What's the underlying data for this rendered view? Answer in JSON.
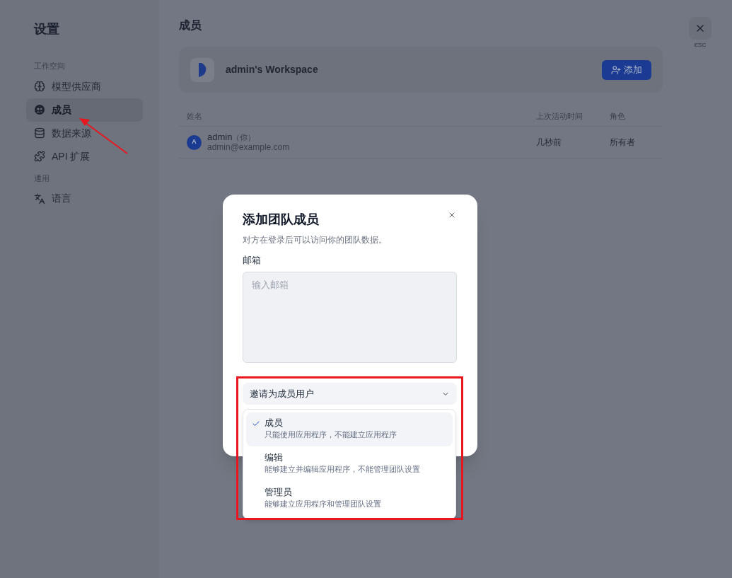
{
  "sidebar": {
    "title": "设置",
    "sections": [
      {
        "heading": "工作空间",
        "items": [
          {
            "label": "模型供应商",
            "kind": "brain",
            "selected": false
          },
          {
            "label": "成员",
            "kind": "members",
            "selected": true
          },
          {
            "label": "数据来源",
            "kind": "database",
            "selected": false
          },
          {
            "label": "API 扩展",
            "kind": "puzzle",
            "selected": false
          }
        ]
      },
      {
        "heading": "通用",
        "items": [
          {
            "label": "语言",
            "kind": "language",
            "selected": false
          }
        ]
      }
    ]
  },
  "main": {
    "title": "成员",
    "close": {
      "hint": "ESC"
    },
    "workspace": {
      "name": "admin's Workspace",
      "add_button": "添加"
    },
    "table": {
      "columns": [
        "姓名",
        "上次活动时间",
        "角色"
      ],
      "rows": [
        {
          "avatar": "A",
          "name": "admin",
          "tag": "（你）",
          "email": "admin@example.com",
          "last_active": "几秒前",
          "role": "所有者"
        }
      ]
    }
  },
  "dialog": {
    "title": "添加团队成员",
    "description": "对方在登录后可以访问你的团队数据。",
    "email_label": "邮箱",
    "email_placeholder": "输入邮箱",
    "role_select": {
      "value": "邀请为成员用户",
      "expanded": true,
      "options": [
        {
          "label": "成员",
          "description": "只能使用应用程序，不能建立应用程序",
          "selected": true
        },
        {
          "label": "编辑",
          "description": "能够建立并编辑应用程序，不能管理团队设置",
          "selected": false
        },
        {
          "label": "管理员",
          "description": "能够建立应用程序和管理团队设置",
          "selected": false
        }
      ]
    }
  }
}
